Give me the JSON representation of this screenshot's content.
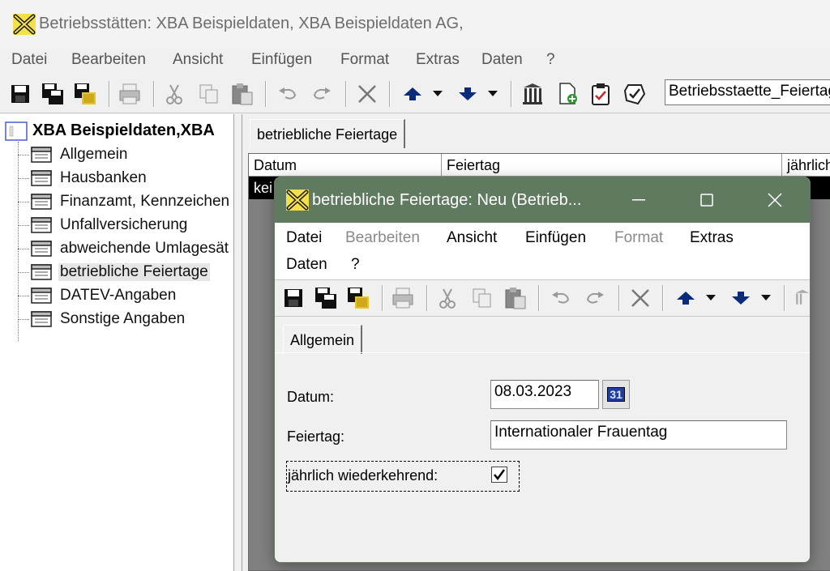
{
  "main_window": {
    "title": "Betriebsstätten: XBA Beispieldaten, XBA Beispieldaten AG,",
    "menu": [
      "Datei",
      "Bearbeiten",
      "Ansicht",
      "Einfügen",
      "Format",
      "Extras",
      "Daten",
      "?"
    ],
    "toolbar_icons": [
      "save-icon",
      "save-all-icon",
      "save-close-icon",
      "print-icon",
      "cut-icon",
      "copy-icon",
      "paste-icon",
      "undo-icon",
      "redo-icon",
      "delete-icon",
      "arrow-up-icon",
      "dropdown-icon",
      "arrow-down-icon",
      "dropdown-icon",
      "library-icon",
      "new-document-icon",
      "clipboard-check-icon",
      "check-badge-icon"
    ],
    "combo_value": "Betriebsstaette_Feiertag",
    "tree": {
      "root": "XBA Beispieldaten,XBA",
      "items": [
        {
          "label": "Allgemein"
        },
        {
          "label": "Hausbanken"
        },
        {
          "label": "Finanzamt, Kennzeichen"
        },
        {
          "label": "Unfallversicherung"
        },
        {
          "label": "abweichende Umlagesät"
        },
        {
          "label": "betriebliche Feiertage",
          "selected": true
        },
        {
          "label": "DATEV-Angaben"
        },
        {
          "label": "Sonstige Angaben"
        }
      ]
    },
    "tab": "betriebliche Feiertage",
    "grid": {
      "columns": [
        "Datum",
        "Feiertag",
        "jährlich"
      ],
      "row_text": "kei"
    }
  },
  "dialog": {
    "title": "betriebliche Feiertage: Neu (Betrieb...",
    "controls": [
      "minimize-icon",
      "maximize-icon",
      "close-icon"
    ],
    "menu": [
      {
        "label": "Datei",
        "enabled": true
      },
      {
        "label": "Bearbeiten",
        "enabled": false
      },
      {
        "label": "Ansicht",
        "enabled": true
      },
      {
        "label": "Einfügen",
        "enabled": true
      },
      {
        "label": "Format",
        "enabled": false
      },
      {
        "label": "Extras",
        "enabled": true
      },
      {
        "label": "Daten",
        "enabled": true
      },
      {
        "label": "?",
        "enabled": true
      }
    ],
    "tab": "Allgemein",
    "fields": {
      "datum_label": "Datum:",
      "datum_value": "08.03.2023",
      "calendar_label": "31",
      "feiertag_label": "Feiertag:",
      "feiertag_value": "Internationaler Frauentag",
      "jaehrlich_label": "jährlich wiederkehrend:",
      "jaehrlich_checked": true
    }
  },
  "colors": {
    "dialog_title_bg": "#5f7a5f",
    "selection_black": "#000000",
    "calendar_blue": "#1d3f9e"
  }
}
